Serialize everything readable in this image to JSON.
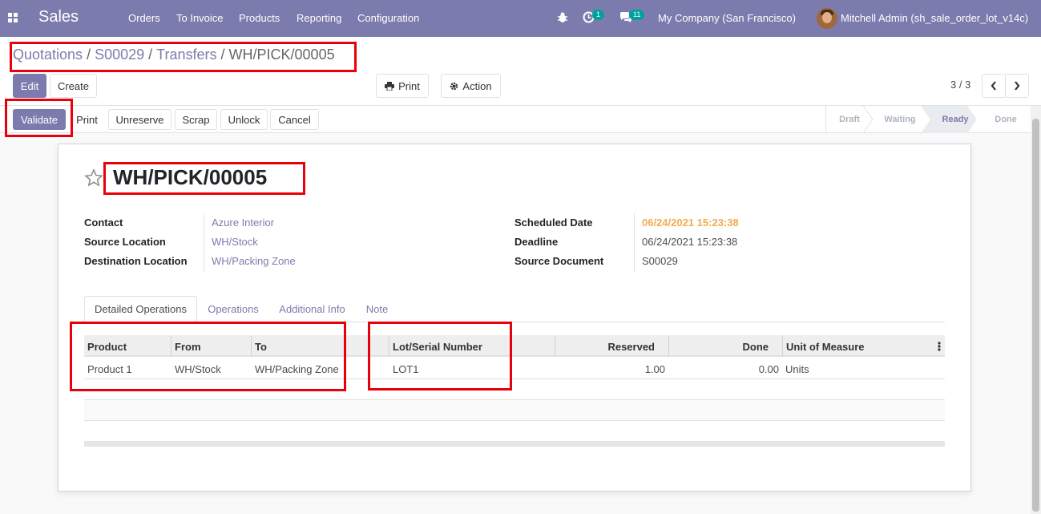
{
  "navbar": {
    "brand": "Sales",
    "menu": [
      "Orders",
      "To Invoice",
      "Products",
      "Reporting",
      "Configuration"
    ],
    "activity_count": "1",
    "message_count": "11",
    "company": "My Company (San Francisco)",
    "user": "Mitchell Admin (sh_sale_order_lot_v14c)",
    "color": "#7c7bad"
  },
  "breadcrumb": {
    "items": [
      "Quotations",
      "S00029",
      "Transfers"
    ],
    "separator": "/",
    "current": "WH/PICK/00005"
  },
  "toolbar": {
    "edit": "Edit",
    "create": "Create",
    "print": "Print",
    "action": "Action",
    "pager": "3 / 3"
  },
  "statusbar": {
    "buttons": [
      "Validate",
      "Print",
      "Unreserve",
      "Scrap",
      "Unlock",
      "Cancel"
    ],
    "stages": [
      "Draft",
      "Waiting",
      "Ready",
      "Done"
    ],
    "active_stage": "Ready"
  },
  "form": {
    "title": "WH/PICK/00005",
    "left": [
      {
        "label": "Contact",
        "value": "Azure Interior"
      },
      {
        "label": "Source Location",
        "value": "WH/Stock"
      },
      {
        "label": "Destination Location",
        "value": "WH/Packing Zone"
      }
    ],
    "right": [
      {
        "label": "Scheduled Date",
        "value": "06/24/2021 15:23:38"
      },
      {
        "label": "Deadline",
        "value": "06/24/2021 15:23:38"
      },
      {
        "label": "Source Document",
        "value": "S00029"
      }
    ],
    "scheduled_color": "#f0ad4e"
  },
  "tabs": [
    "Detailed Operations",
    "Operations",
    "Additional Info",
    "Note"
  ],
  "table": {
    "columns": [
      "Product",
      "From",
      "To",
      "",
      "Lot/Serial Number",
      "Reserved",
      "Done",
      "Unit of Measure"
    ],
    "rows": [
      {
        "product": "Product 1",
        "from": "WH/Stock",
        "to": "WH/Packing Zone",
        "lot": "LOT1",
        "reserved": "1.00",
        "done": "0.00",
        "uom": "Units"
      }
    ]
  },
  "highlight_color": "#e8000b"
}
